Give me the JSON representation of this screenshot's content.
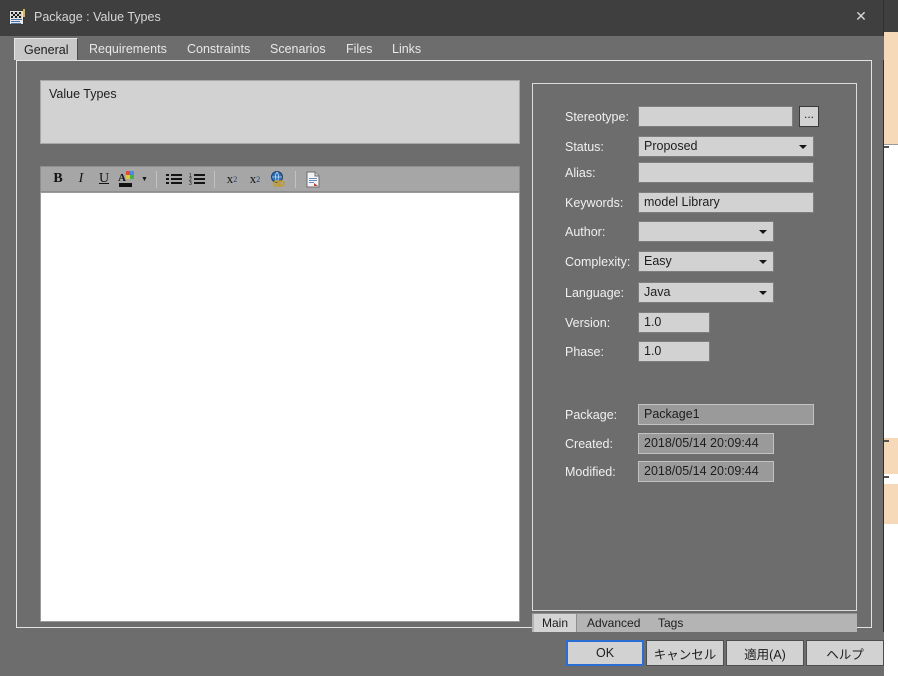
{
  "window": {
    "title": "Package : Value Types",
    "icon": "package-document-icon",
    "close_label": "✕"
  },
  "tabs": [
    {
      "label": "General",
      "active": true
    },
    {
      "label": "Requirements",
      "active": false
    },
    {
      "label": "Constraints",
      "active": false
    },
    {
      "label": "Scenarios",
      "active": false
    },
    {
      "label": "Files",
      "active": false
    },
    {
      "label": "Links",
      "active": false
    }
  ],
  "left_pane": {
    "name_value": "Value Types",
    "notes_value": "",
    "toolbar": [
      {
        "name": "bold-icon",
        "label": "B",
        "kind": "bold"
      },
      {
        "name": "italic-icon",
        "label": "I",
        "kind": "italic"
      },
      {
        "name": "underline-icon",
        "label": "U",
        "kind": "underline"
      },
      {
        "name": "font-color-icon",
        "label": "A",
        "kind": "fontcolor"
      },
      {
        "name": "bulleted-list-icon",
        "label": "☰",
        "kind": "bullets"
      },
      {
        "name": "numbered-list-icon",
        "label": "☰",
        "kind": "numbers"
      },
      {
        "name": "superscript-icon",
        "label": "x2",
        "kind": "sup"
      },
      {
        "name": "subscript-icon",
        "label": "x2",
        "kind": "sub"
      },
      {
        "name": "hyperlink-icon",
        "label": "●",
        "kind": "link"
      },
      {
        "name": "insert-document-icon",
        "label": "▤",
        "kind": "doc"
      }
    ]
  },
  "properties": {
    "fields": [
      {
        "name": "stereotype",
        "label": "Stereotype:",
        "value": "",
        "type": "text-with-browse",
        "browse_label": "..."
      },
      {
        "name": "status",
        "label": "Status:",
        "value": "Proposed",
        "type": "combo"
      },
      {
        "name": "alias",
        "label": "Alias:",
        "value": "",
        "type": "text"
      },
      {
        "name": "keywords",
        "label": "Keywords:",
        "value": "model Library",
        "type": "text"
      },
      {
        "name": "author",
        "label": "Author:",
        "value": "",
        "type": "combo"
      },
      {
        "name": "complexity",
        "label": "Complexity:",
        "value": "Easy",
        "type": "combo"
      },
      {
        "name": "language",
        "label": "Language:",
        "value": "Java",
        "type": "combo"
      },
      {
        "name": "version",
        "label": "Version:",
        "value": "1.0",
        "type": "text"
      },
      {
        "name": "phase",
        "label": "Phase:",
        "value": "1.0",
        "type": "text"
      },
      {
        "name": "package",
        "label": "Package:",
        "value": "Package1",
        "type": "readonly"
      },
      {
        "name": "created",
        "label": "Created:",
        "value": "2018/05/14 20:09:44",
        "type": "readonly"
      },
      {
        "name": "modified",
        "label": "Modified:",
        "value": "2018/05/14 20:09:44",
        "type": "readonly"
      }
    ]
  },
  "subtabs": [
    {
      "label": "Main",
      "active": true
    },
    {
      "label": "Advanced",
      "active": false
    },
    {
      "label": "Tags",
      "active": false
    }
  ],
  "footer": {
    "buttons": [
      {
        "label": "OK",
        "default": true
      },
      {
        "label": "キャンセル",
        "default": false
      },
      {
        "label": "適用(A)",
        "default": false
      },
      {
        "label": "ヘルプ",
        "default": false
      }
    ]
  },
  "colors": {
    "window_bg": "#6d6d6d",
    "titlebar": "#3f3f3f",
    "field_bg": "#d2d2d2",
    "readonly_bg": "#9a9a9a",
    "accent": "#2a6ed4"
  }
}
